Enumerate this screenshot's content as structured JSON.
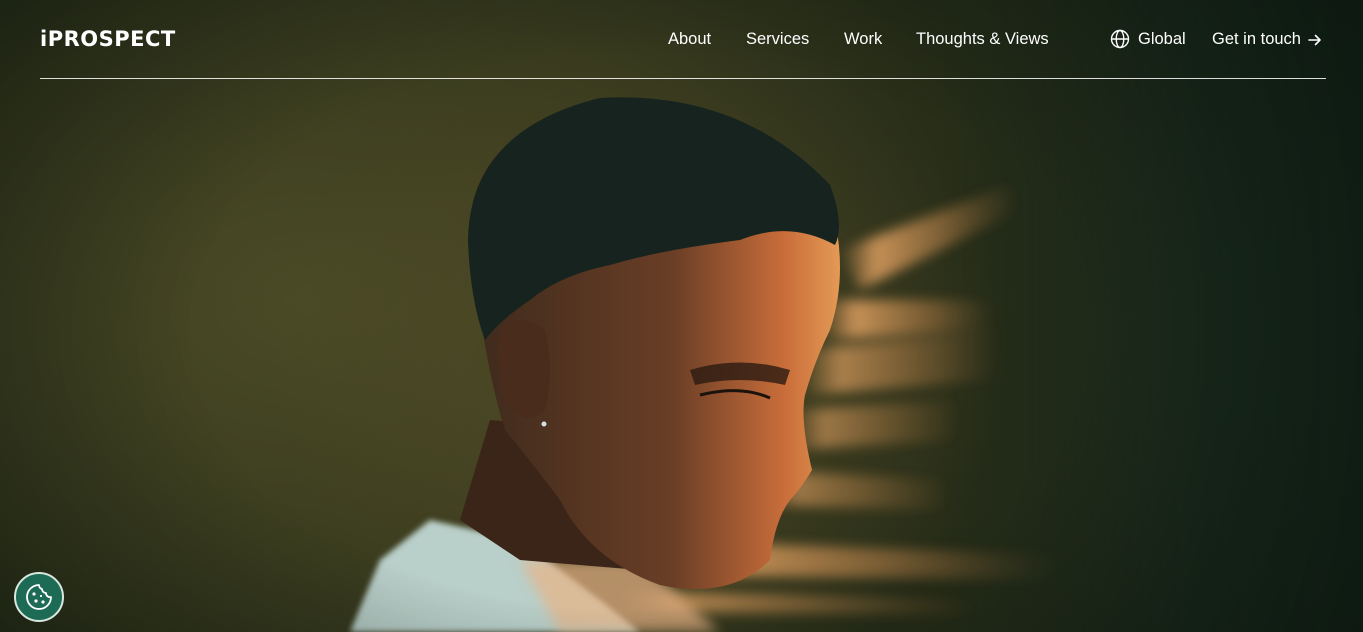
{
  "brand": {
    "logo_text": "iPROSPECT"
  },
  "nav": {
    "items": [
      {
        "label": "About"
      },
      {
        "label": "Services"
      },
      {
        "label": "Work"
      },
      {
        "label": "Thoughts & Views"
      }
    ],
    "region": {
      "label": "Global",
      "icon": "globe-icon"
    },
    "cta": {
      "label": "Get in touch",
      "icon": "arrow-right-icon"
    }
  },
  "hero": {
    "image": "portrait-of-man-with-motion-blur"
  },
  "cookie_button": {
    "icon": "cookie-icon"
  },
  "colors": {
    "header_text": "#ffffff",
    "background": "#2d3a1f",
    "cookie_bg": "#1e6b55"
  }
}
